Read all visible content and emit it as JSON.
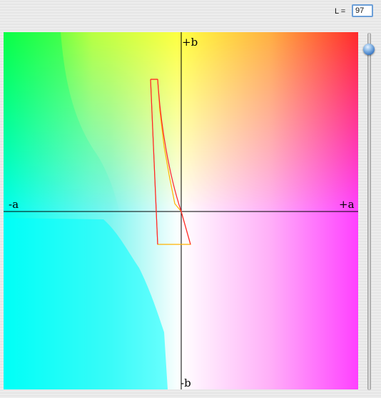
{
  "controls": {
    "l_label": "L =",
    "l_value": "97"
  },
  "plot": {
    "axis_labels": {
      "plus_b": "+b",
      "minus_b": "-b",
      "plus_a": "+a",
      "minus_a": "-a"
    }
  },
  "colors": {
    "gamut_outline_red": "#ff2030",
    "gamut_outline_yellow": "#ffb300",
    "axis": "#000000"
  }
}
